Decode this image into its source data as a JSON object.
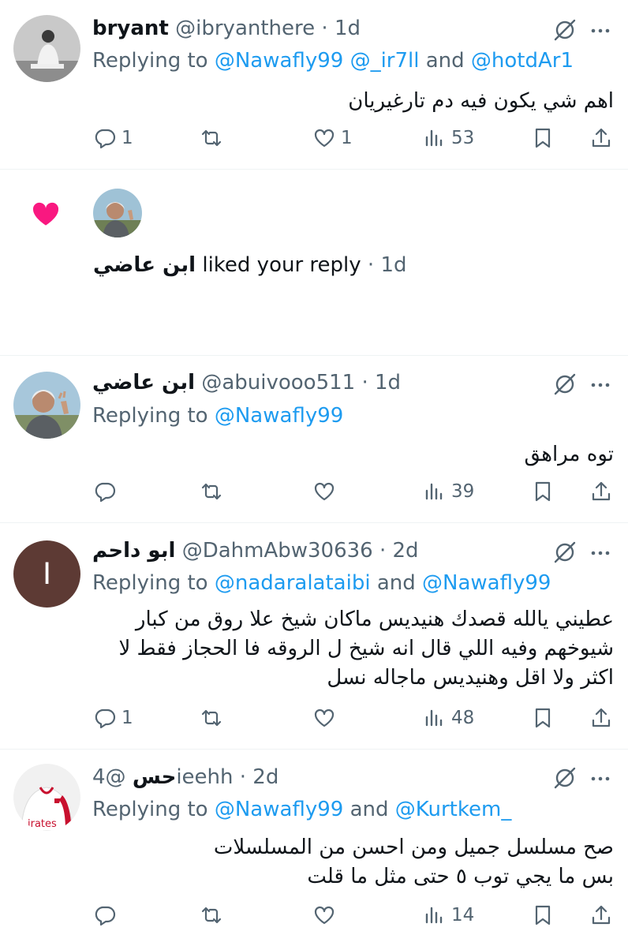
{
  "posts": [
    {
      "name": "bryant",
      "handle": "@ibryanthere",
      "dot": "·",
      "time": "1d",
      "reply_prefix": "Replying to",
      "reply_m1": "@Nawafly99",
      "reply_m2": "@_ir7ll",
      "reply_and": "and",
      "reply_m3": "@hotdAr1",
      "text": "اهم شي يكون فيه دم تارغيريان",
      "replies": "1",
      "reposts": "",
      "likes": "1",
      "views": "53"
    },
    {
      "name": "ابن عاضي",
      "handle": "@abuivooo511",
      "dot": "·",
      "time": "1d",
      "reply_prefix": "Replying to",
      "reply_m1": "@Nawafly99",
      "text": "توه مراهق",
      "replies": "",
      "reposts": "",
      "likes": "",
      "views": "39"
    },
    {
      "name": "ابو داحم",
      "handle": "@DahmAbw30636",
      "dot": "·",
      "time": "2d",
      "avatar_letter": "I",
      "reply_prefix": "Replying to",
      "reply_m1": "@nadaralataibi",
      "reply_and": "and",
      "reply_m2": "@Nawafly99",
      "text": "عطيني يالله قصدك هنيديس ماكان شيخ علا روق من كبار شيوخهم وفيه اللي قال انه شيخ ل الروقه فا الحجاز فقط لا اكثر ولا اقل وهنيديس ماجاله نسل",
      "replies": "1",
      "reposts": "",
      "likes": "",
      "views": "48"
    },
    {
      "name": "حس",
      "handle": "@4ieehh",
      "dot": "·",
      "time": "2d",
      "reply_prefix": "Replying to",
      "reply_m1": "@Nawafly99",
      "reply_and": "and",
      "reply_m2": "@Kurtkem_",
      "text_line1": "صح مسلسل جميل ومن احسن من المسلسلات",
      "text_line2": "بس ما يجي توب ٥ حتى مثل ما قلت",
      "replies": "",
      "reposts": "",
      "likes": "",
      "views": "14"
    }
  ],
  "like_notification": {
    "name": "ابن عاضي",
    "text": "liked your reply",
    "dot": "·",
    "time": "1d"
  },
  "icons": {
    "like_notification": "heart-filled-icon",
    "grok": "grok-icon",
    "more": "more-dots-icon",
    "reply": "reply-icon",
    "repost": "repost-icon",
    "like": "heart-icon",
    "views": "views-icon",
    "bookmark": "bookmark-icon",
    "share": "share-icon"
  },
  "colors": {
    "accent": "#1d9bf0",
    "muted": "#536471",
    "heart": "#f91880",
    "avatar_letter_bg": "#5d3a34"
  }
}
